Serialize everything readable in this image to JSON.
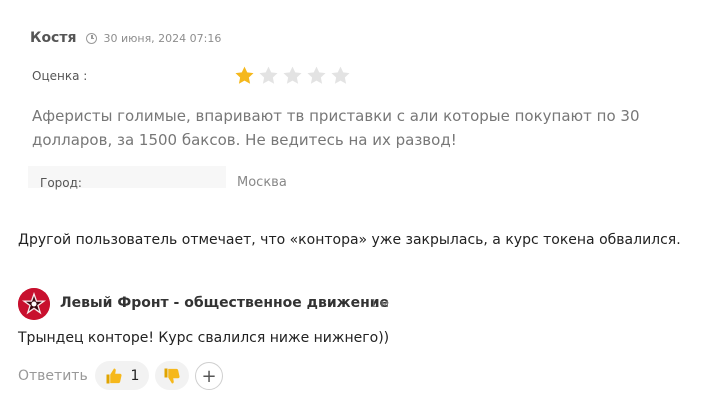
{
  "review": {
    "author": "Костя",
    "date": "30 июня, 2024 07:16",
    "rating_label": "Оценка :",
    "rating": 1,
    "rating_max": 5,
    "star_color_on": "#f5b81c",
    "star_color_off": "#e3e3e3",
    "text": "Аферисты голимые, впаривают тв приставки с али которые покупают по 30 долларов, за 1500 баксов. Не ведитесь на их развод!",
    "city_label": "Город:",
    "city_value": "Москва"
  },
  "note": "Другой пользователь отмечает, что «контора» уже закрылась, а курс токена обвалился.",
  "comment": {
    "author": "Левый Фронт - общественное движение",
    "time": "1 м",
    "text": "Трындец конторе! Курс свалился ниже нижнего))",
    "reply_label": "Ответить",
    "likes": "1",
    "avatar_color": "#c8102e"
  }
}
